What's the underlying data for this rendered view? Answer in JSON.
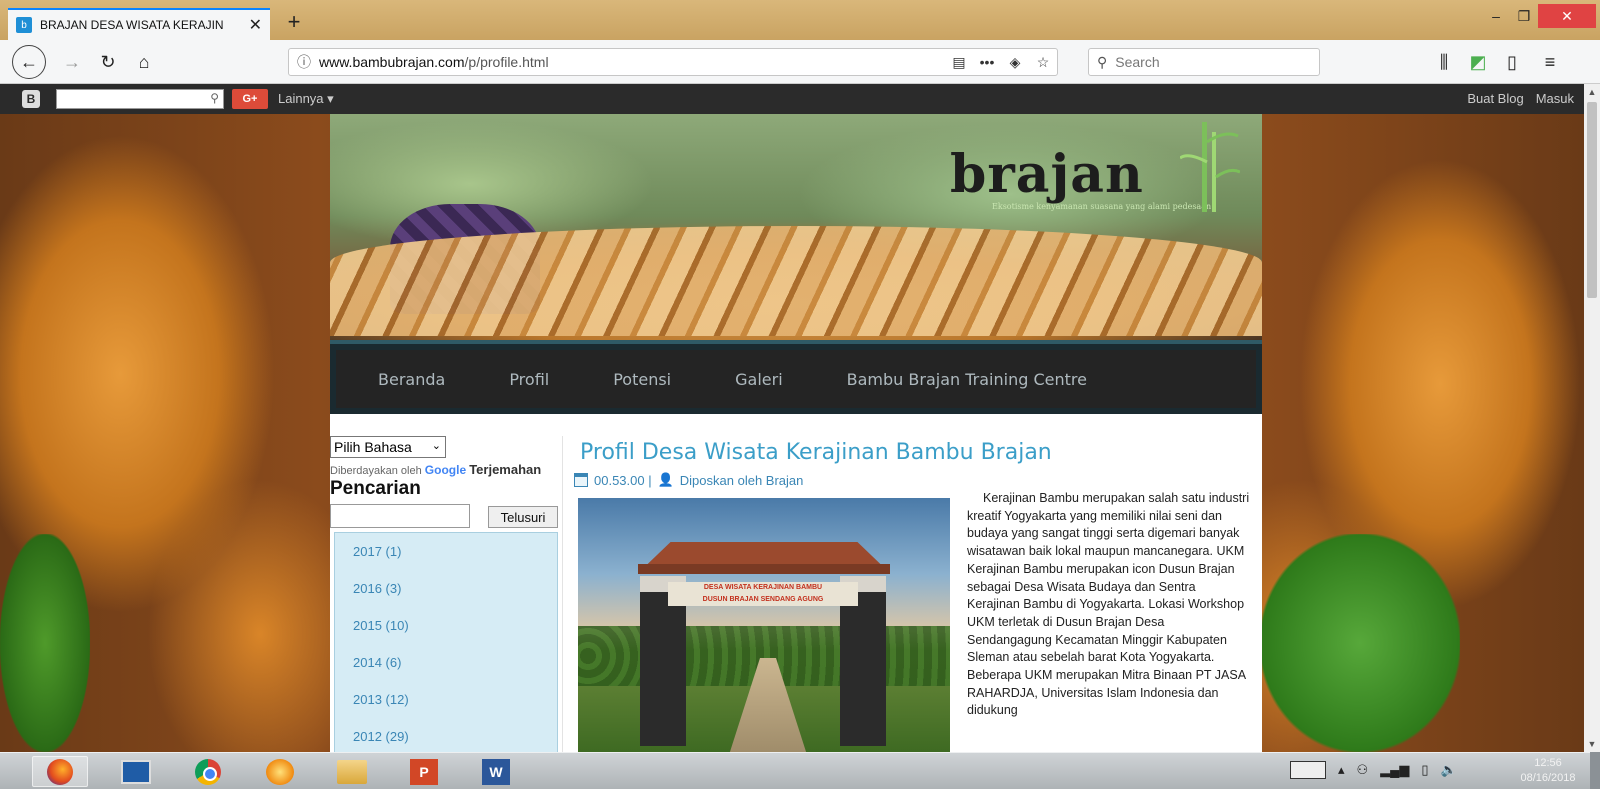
{
  "browser": {
    "tab_title": "BRAJAN DESA WISATA KERAJIN",
    "tab_close": "✕",
    "new_tab": "+",
    "url_domain": "www.bambubrajan.com",
    "url_path": "/p/profile.html",
    "search_placeholder": "Search",
    "window_min": "–",
    "window_max": "❐",
    "window_close": "✕"
  },
  "blogger_bar": {
    "gplus_label": "G+",
    "more_label": "Lainnya ▾",
    "create_blog": "Buat Blog",
    "sign_in": "Masuk"
  },
  "header": {
    "logo_text": "brajan",
    "tagline": "Eksotisme kenyamanan suasana yang alami pedesaan"
  },
  "menu": {
    "items": [
      "Beranda",
      "Profil",
      "Potensi",
      "Galeri",
      "Bambu Brajan Training Centre"
    ]
  },
  "sidebar": {
    "language_select": "Pilih Bahasa",
    "powered_prefix": "Diberdayakan oleh",
    "powered_google": "Google",
    "powered_translate": "Terjemahan",
    "search_heading": "Pencarian",
    "search_button": "Telusuri",
    "archive": [
      "2017 (1)",
      "2016 (3)",
      "2015 (10)",
      "2014 (6)",
      "2013 (12)",
      "2012 (29)"
    ]
  },
  "post": {
    "title": "Profil Desa Wisata Kerajinan Bambu Brajan",
    "time": "00.53.00 |",
    "author": "Diposkan oleh Brajan",
    "gate_sign_1": "DESA WISATA KERAJINAN BAMBU",
    "gate_sign_2": "DUSUN BRAJAN SENDANG AGUNG",
    "body": "Kerajinan Bambu merupakan salah satu industri kreatif Yogyakarta yang memiliki nilai seni dan budaya yang sangat tinggi serta digemari banyak wisatawan baik lokal maupun mancanegara. UKM Kerajinan Bambu merupakan icon Dusun Brajan sebagai Desa Wisata Budaya dan Sentra Kerajinan Bambu di Yogyakarta. Lokasi Workshop UKM terletak di Dusun Brajan Desa Sendangagung Kecamatan Minggir Kabupaten Sleman atau sebelah barat Kota Yogyakarta. Beberapa UKM merupakan Mitra Binaan PT JASA RAHARDJA, Universitas Islam Indonesia dan didukung"
  },
  "taskbar": {
    "time": "12:56",
    "date": "08/16/2018",
    "powerpoint_label": "P",
    "word_label": "W"
  },
  "colors": {
    "accent_link": "#3b9ec8",
    "menu_bg": "#242424",
    "archive_bg": "#d6ecf5",
    "close_red": "#e04343"
  },
  "icons": [
    "firefox-icon",
    "monitor-icon",
    "chrome-icon",
    "ubuntu-icon",
    "file-explorer-icon",
    "powerpoint-icon",
    "word-icon"
  ]
}
